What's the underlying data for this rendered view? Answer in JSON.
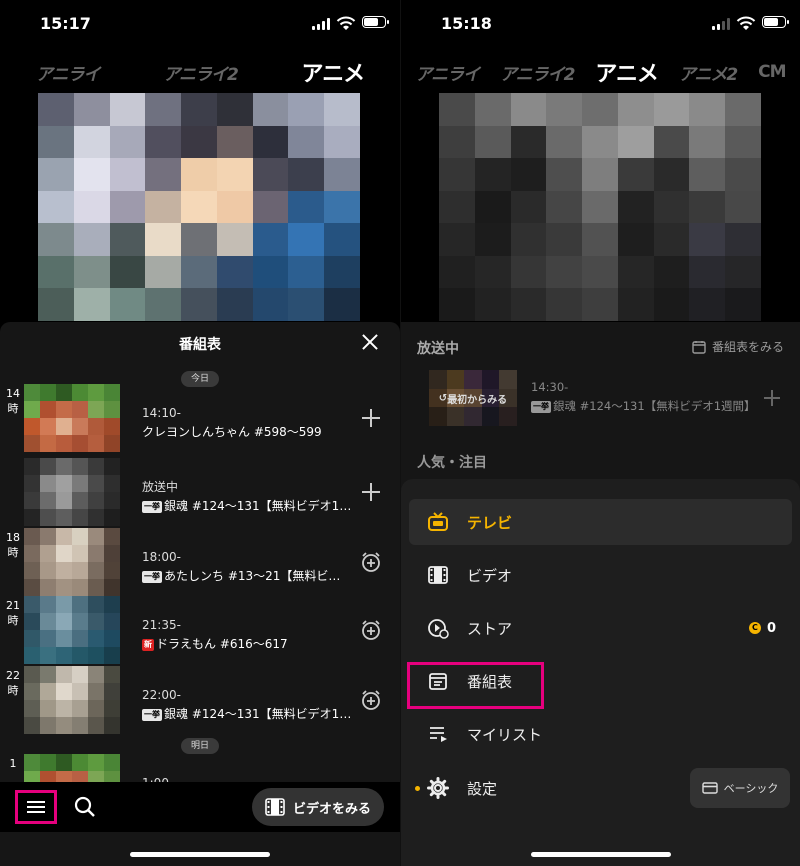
{
  "left": {
    "status": {
      "time": "15:17",
      "battery_level": 0.62
    },
    "channels": [
      {
        "label": "アニライ",
        "active": false
      },
      {
        "label": "アニライ2",
        "active": false
      },
      {
        "label": "アニメ",
        "active": true
      }
    ],
    "schedule": {
      "title": "番組表",
      "today_label": "今日",
      "tomorrow_label": "明日",
      "rows": [
        {
          "hour_num": "14",
          "hour_unit": "時",
          "time": "14:10-",
          "title": "クレヨンしんちゃん #598〜599",
          "badge": "",
          "action": "add"
        },
        {
          "hour_num": "",
          "hour_unit": "",
          "time": "放送中",
          "title": "銀魂 #124〜131【無料ビデオ1…",
          "badge": "一挙",
          "action": "add"
        },
        {
          "hour_num": "18",
          "hour_unit": "時",
          "time": "18:00-",
          "title": "あたしンち #13〜21【無料ビデ…",
          "badge": "一挙",
          "action": "alarm"
        },
        {
          "hour_num": "21",
          "hour_unit": "時",
          "time": "21:35-",
          "title": "ドラえもん #616〜617",
          "badge": "新",
          "action": "alarm"
        },
        {
          "hour_num": "22",
          "hour_unit": "時",
          "time": "22:00-",
          "title": "銀魂 #124〜131【無料ビデオ1…",
          "badge": "一挙",
          "action": "alarm"
        }
      ],
      "next_row": {
        "hour_num": "1",
        "time": "1:00-"
      }
    },
    "bottom": {
      "video_button": "ビデオをみる"
    }
  },
  "right": {
    "status": {
      "time": "15:18",
      "battery_level": 0.62
    },
    "channels": [
      {
        "label": "アニライ",
        "active": false
      },
      {
        "label": "アニライ2",
        "active": false
      },
      {
        "label": "アニメ",
        "active": true
      },
      {
        "label": "アニメ2",
        "active": false
      },
      {
        "label": "CM",
        "active": false
      }
    ],
    "onair": {
      "title": "放送中",
      "see_schedule": "番組表をみる",
      "restart_label": "最初からみる",
      "time": "14:30-",
      "badge": "一挙",
      "program": "銀魂 #124〜131【無料ビデオ1週間】"
    },
    "popular_title": "人気・注目",
    "menu": {
      "items": [
        {
          "label": "テレビ",
          "icon": "tv-icon",
          "active": true
        },
        {
          "label": "ビデオ",
          "icon": "film-icon",
          "active": false
        },
        {
          "label": "ストア",
          "icon": "store-icon",
          "active": false
        },
        {
          "label": "番組表",
          "icon": "calendar-icon",
          "active": false
        },
        {
          "label": "マイリスト",
          "icon": "playlist-icon",
          "active": false
        },
        {
          "label": "設定",
          "icon": "gear-icon",
          "active": false
        }
      ],
      "coin_count": "0",
      "plan_label": "ベーシック"
    }
  },
  "colors": {
    "accent": "#f5b400",
    "highlight": "#e6007e"
  }
}
